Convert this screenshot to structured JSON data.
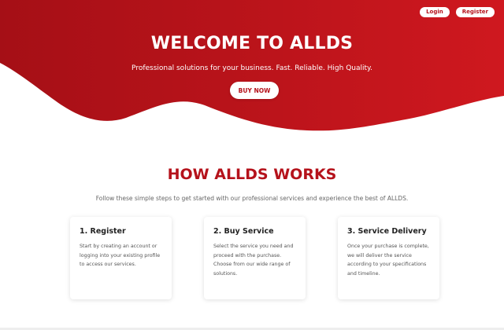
{
  "colors": {
    "brand": "#b5121b",
    "brand_light": "#d1181f",
    "text_dark": "#222222",
    "text_muted": "#666666"
  },
  "header": {
    "login_label": "Login",
    "register_label": "Register"
  },
  "hero": {
    "title": "WELCOME TO ALLDS",
    "subtitle": "Professional solutions for your business. Fast. Reliable. High Quality.",
    "cta_label": "BUY NOW"
  },
  "how": {
    "title": "HOW ALLDS WORKS",
    "subtitle": "Follow these simple steps to get started with our professional services and experience the best of ALLDS.",
    "steps": [
      {
        "title": "1. Register",
        "text": "Start by creating an account or logging into your existing profile to access our services."
      },
      {
        "title": "2. Buy Service",
        "text": "Select the service you need and proceed with the purchase. Choose from our wide range of solutions."
      },
      {
        "title": "3. Service Delivery",
        "text": "Once your purchase is complete, we will deliver the service according to your specifications and timeline."
      }
    ]
  }
}
